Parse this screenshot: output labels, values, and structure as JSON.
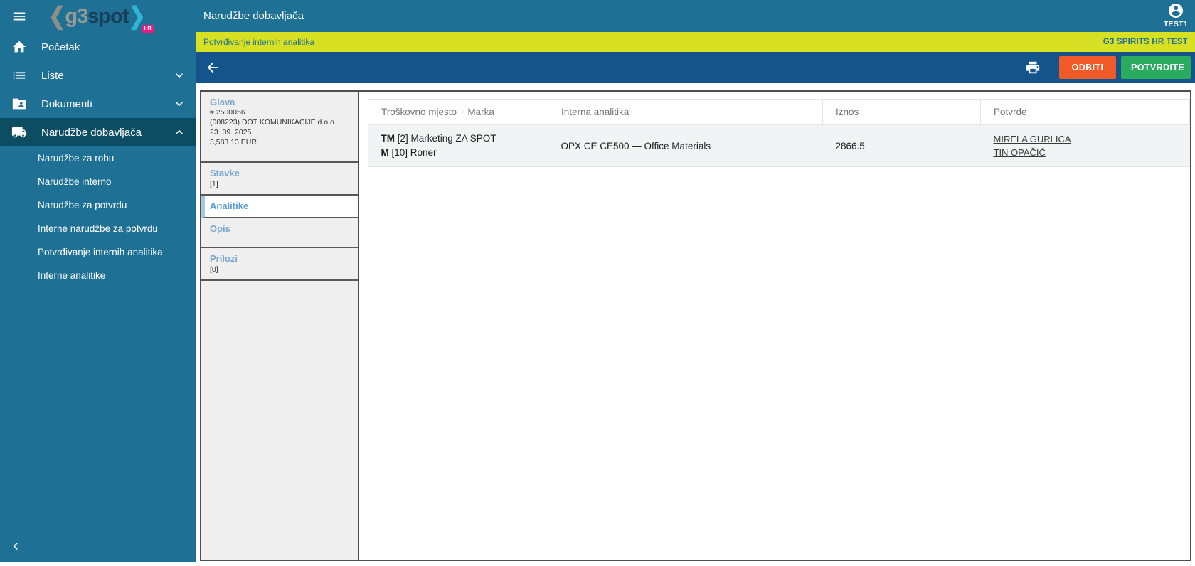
{
  "app": {
    "logo": {
      "chev_left": "❮",
      "g3": "g3",
      "spot": "spot",
      "chev_right": "❯",
      "badge": "HR"
    },
    "title": "Narudžbe dobavljača",
    "user": "TEST1"
  },
  "banner": {
    "left": "Potvrđivanje internih analitika",
    "right": "G3 SPIRITS HR TEST"
  },
  "toolbar": {
    "reject": "ODBITI",
    "confirm": "POTVRDITE"
  },
  "sidebar": {
    "items": [
      {
        "label": "Početak",
        "icon": "home-icon"
      },
      {
        "label": "Liste",
        "icon": "list-icon",
        "chevron": "down"
      },
      {
        "label": "Dokumenti",
        "icon": "documents-icon",
        "chevron": "down"
      },
      {
        "label": "Narudžbe dobavljača",
        "icon": "truck-icon",
        "chevron": "up",
        "active": true
      }
    ],
    "submenu": [
      {
        "label": "Narudžbe za robu"
      },
      {
        "label": "Narudžbe interno"
      },
      {
        "label": "Narudžbe za potvrdu"
      },
      {
        "label": "Interne narudžbe za potvrdu"
      },
      {
        "label": "Potvrđivanje internih analitika"
      },
      {
        "label": "Interne analitike"
      }
    ]
  },
  "tabs": {
    "glava": {
      "label": "Glava",
      "lines": [
        "# 2500056",
        "(008223) DOT KOMUNIKACIJE d.o.o.",
        "23. 09. 2025.",
        "3,583.13 EUR"
      ]
    },
    "stavke": {
      "label": "Stavke",
      "count": "[1]"
    },
    "analitike": {
      "label": "Analitike",
      "active": true
    },
    "opis": {
      "label": "Opis"
    },
    "prilozi": {
      "label": "Prilozi",
      "count": "[0]"
    }
  },
  "table": {
    "columns": [
      "Troškovno mjesto + Marka",
      "Interna analitika",
      "Iznos",
      "Potvrde"
    ],
    "row": {
      "tm_code": "TM",
      "tm_rest": " [2] Marketing ZA SPOT",
      "m_code": "M",
      "m_rest": " [10] Roner",
      "analitika": "OPX CE CE500 — Office Materials",
      "iznos": "2866.5",
      "approver1": "MIRELA GURLICA",
      "approver2": "TIN OPAČIĆ"
    }
  },
  "colors": {
    "sidebar_teal": "#1e7095",
    "sidebar_active": "#0d4d64",
    "banner_yellow": "#d7e022",
    "toolbar_blue": "#15538b",
    "reject_orange": "#f05a28",
    "confirm_green": "#2bab60",
    "badge_pink": "#ed1a7f",
    "tab_label_blue": "#7ba6cb"
  }
}
